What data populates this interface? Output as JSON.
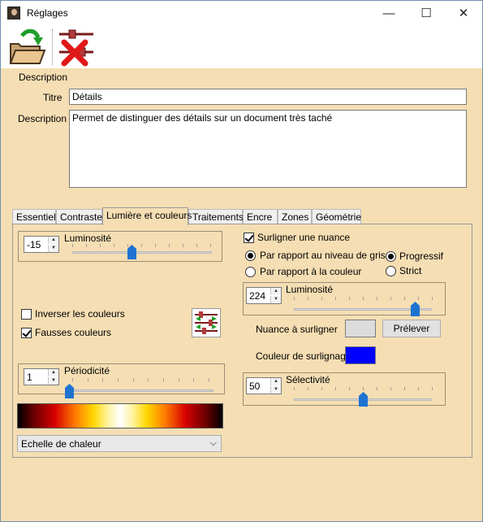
{
  "window": {
    "title": "Réglages",
    "minimize_glyph": "—",
    "maximize_glyph": "☐",
    "close_glyph": "✕"
  },
  "toolbar": {
    "apply_icon": "folder-arrow-icon",
    "delete_icon": "slider-delete-icon"
  },
  "description_section": {
    "heading": "Description",
    "title_label": "Titre",
    "title_value": "Détails",
    "description_label": "Description",
    "description_value": "Permet de distinguer des détails sur un document très taché"
  },
  "tabs": [
    "Essentiel",
    "Contraste",
    "Lumière et couleurs",
    "Traitements",
    "Encre",
    "Zones",
    "Géométrie"
  ],
  "active_tab": "Lumière et couleurs",
  "left": {
    "luminosite": {
      "label": "Luminosité",
      "value": "-15",
      "min": -100,
      "max": 100,
      "position": -15
    },
    "inverser_label": "Inverser les couleurs",
    "inverser_checked": false,
    "fausses_label": "Fausses couleurs",
    "fausses_checked": true,
    "periodicite": {
      "label": "Périodicité",
      "value": "1",
      "min": 1,
      "max": 10,
      "position": 1
    },
    "palette_select": "Echelle de chaleur"
  },
  "right": {
    "surligner_label": "Surligner une nuance",
    "surligner_checked": true,
    "radio_gris": "Par rapport au niveau de gris",
    "radio_couleur": "Par rapport à la couleur",
    "radio_progressif": "Progressif",
    "radio_strict": "Strict",
    "luminosite": {
      "label": "Luminosité",
      "value": "224",
      "min": 0,
      "max": 255,
      "position": 224
    },
    "nuance_label": "Nuance à surligner",
    "prelever_button": "Prélever",
    "couleur_label": "Couleur de surlignage",
    "selectivite": {
      "label": "Sélectivité",
      "value": "50",
      "min": 0,
      "max": 100,
      "position": 50
    }
  },
  "colors": {
    "background": "#f5deb3",
    "nuance_swatch": "#dcdcdc",
    "surlignage_swatch": "#0000ff",
    "slider_thumb": "#1e73d2"
  }
}
